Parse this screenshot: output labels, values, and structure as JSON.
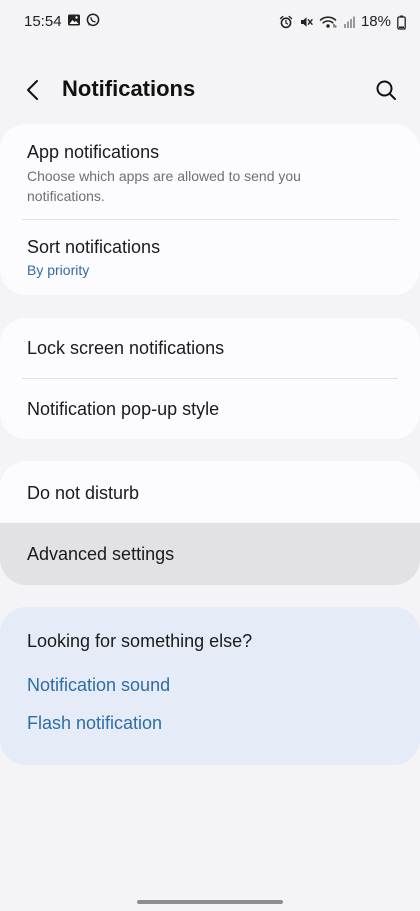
{
  "status_bar": {
    "time": "15:54",
    "battery": "18%",
    "left_icons": [
      "image-icon",
      "whatsapp-icon"
    ],
    "right_icons": [
      "alarm-icon",
      "mute-icon",
      "wifi-icon",
      "signal-icon"
    ]
  },
  "header": {
    "title": "Notifications",
    "back_icon": "chevron-left-icon",
    "search_icon": "search-icon"
  },
  "group_1": {
    "app_notifications": {
      "title": "App notifications",
      "subtitle": "Choose which apps are allowed to send you notifications."
    },
    "sort_notifications": {
      "title": "Sort notifications",
      "subtitle": "By priority"
    }
  },
  "group_2": {
    "lock_screen": "Lock screen notifications",
    "popup_style": "Notification pop-up style"
  },
  "group_3": {
    "do_not_disturb": "Do not disturb",
    "advanced_settings": "Advanced settings"
  },
  "suggestions": {
    "title": "Looking for something else?",
    "links": [
      "Notification sound",
      "Flash notification"
    ]
  },
  "colors": {
    "background": "#f4f4f6",
    "card": "#fcfcfe",
    "suggestion_card": "#e5ebf7",
    "accent": "#2f6da6",
    "highlight_row": "#e2e2e4"
  }
}
